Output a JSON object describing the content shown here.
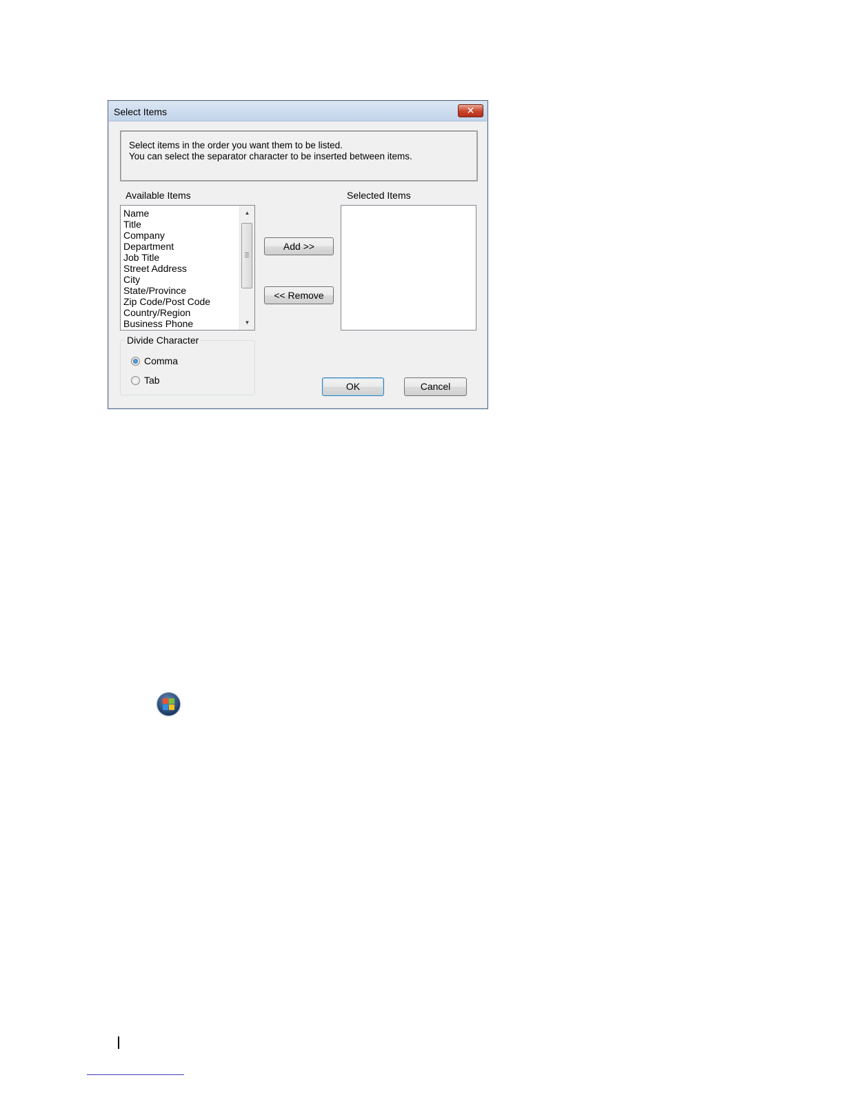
{
  "dialog": {
    "title": "Select Items",
    "close_glyph": "✕",
    "info_lines": [
      "Select items in the order you want them to be listed.",
      "You can select the separator character to be inserted between items."
    ],
    "available_label": "Available Items",
    "available_items": [
      "Name",
      "Title",
      "Company",
      "Department",
      "Job Title",
      "Street Address",
      "City",
      "State/Province",
      "Zip Code/Post Code",
      "Country/Region",
      "Business Phone"
    ],
    "selected_label": "Selected Items",
    "selected_items": [],
    "add_label": "Add >>",
    "remove_label": "<< Remove",
    "divide_label": "Divide Character",
    "radio_options": [
      "Comma",
      "Tab"
    ],
    "radio_selected": "Comma",
    "ok_label": "OK",
    "cancel_label": "Cancel"
  },
  "icons": {
    "scroll_up": "▲",
    "scroll_down": "▼",
    "start_orb": "windows-start-orb-icon"
  }
}
